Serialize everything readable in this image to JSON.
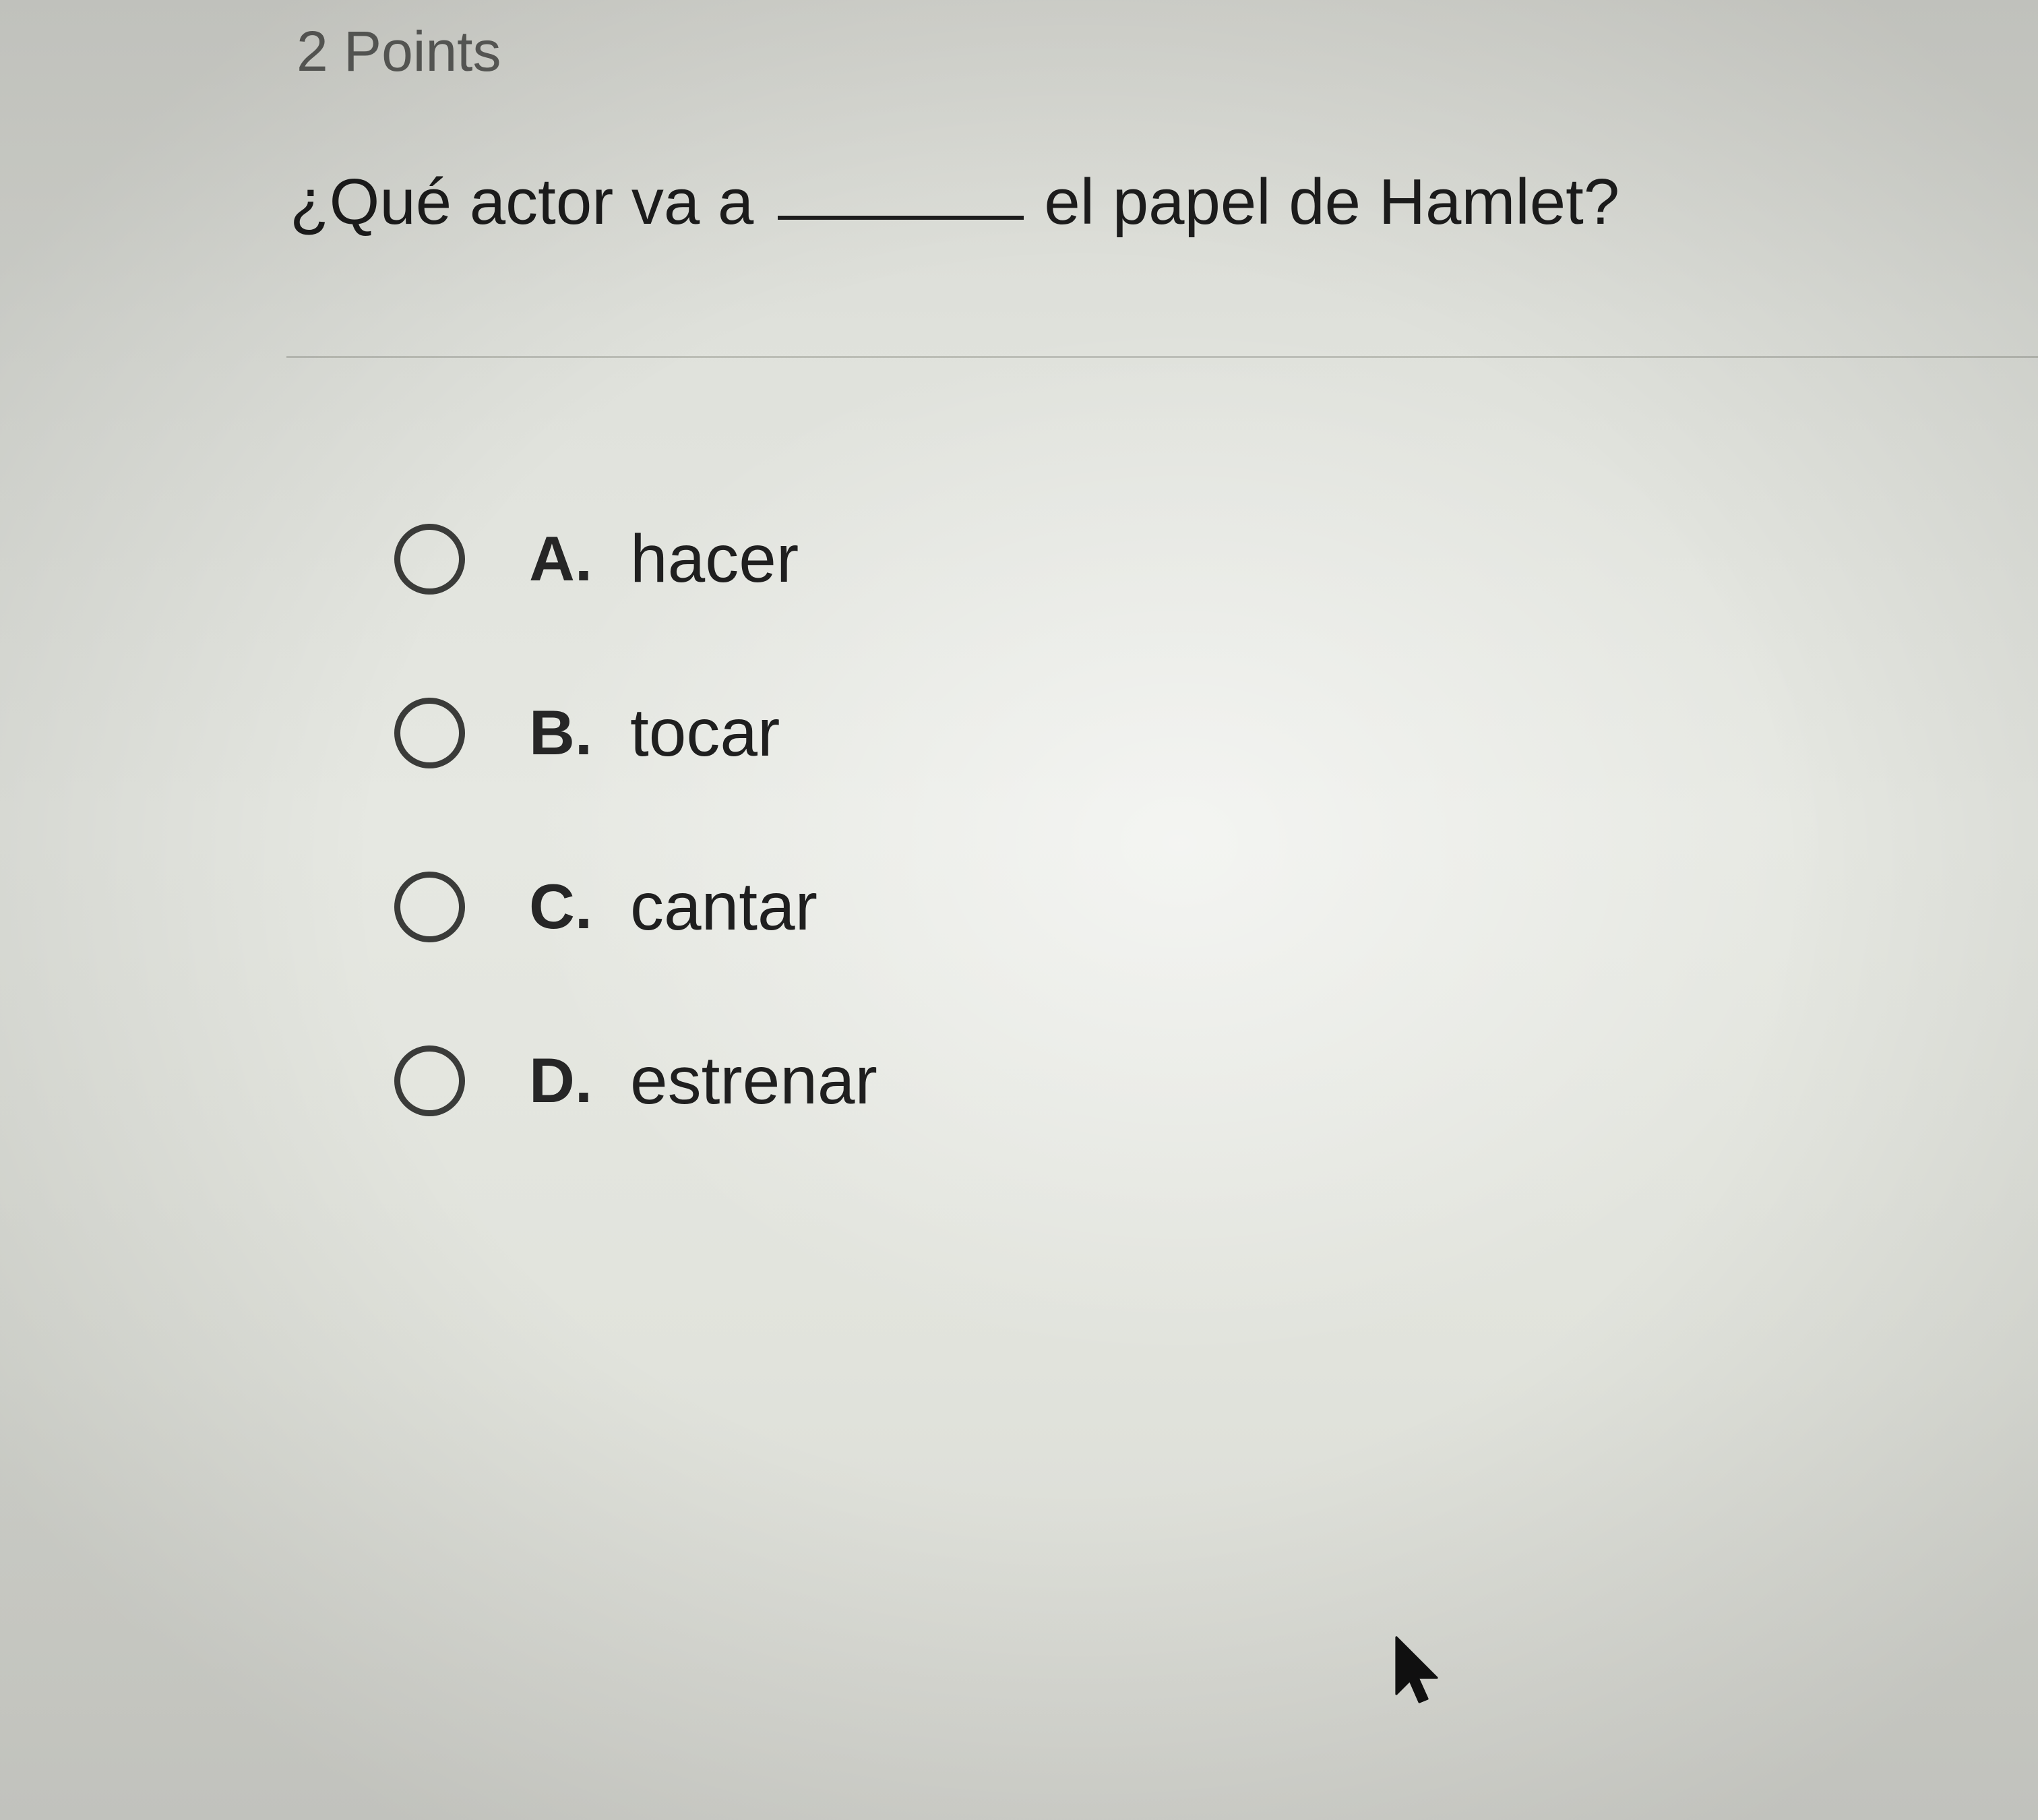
{
  "quiz": {
    "points": "2 Points",
    "question": {
      "before_blank": "¿Qué actor va a",
      "after_blank": "el papel de Hamlet?"
    },
    "options": [
      {
        "letter": "A.",
        "text": "hacer"
      },
      {
        "letter": "B.",
        "text": "tocar"
      },
      {
        "letter": "C.",
        "text": "cantar"
      },
      {
        "letter": "D.",
        "text": "estrenar"
      }
    ]
  },
  "icons": {
    "cursor": "mouse-pointer-icon",
    "radio": "radio-unselected-icon"
  },
  "colors": {
    "text": "#1c1c1c",
    "muted_text": "#5a5b58",
    "radio_border": "#3a3b39",
    "background": "#e3e5df"
  }
}
